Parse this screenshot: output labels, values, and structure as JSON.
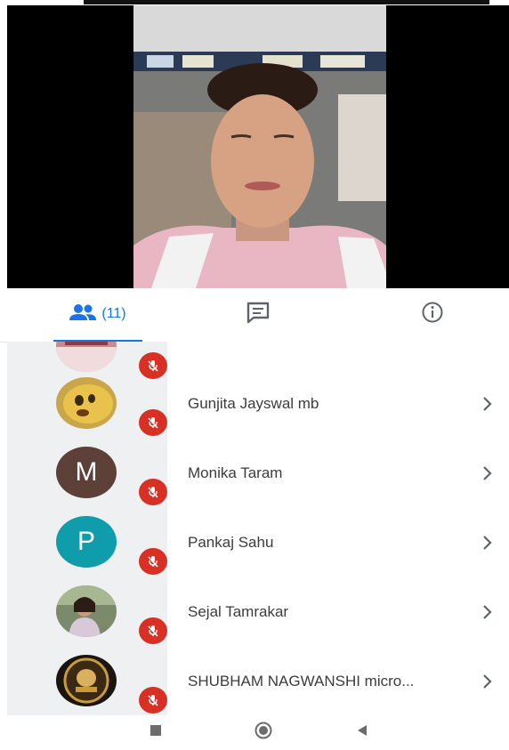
{
  "tabs": {
    "participants_count": "(11)",
    "active": "participants"
  },
  "participants": [
    {
      "name": "",
      "avatar": "photo",
      "muted": true
    },
    {
      "name": "Gunjita Jayswal mb",
      "avatar": "photo",
      "muted": true
    },
    {
      "name": "Monika Taram",
      "avatar": "letter",
      "letter": "M",
      "color": "#5d4037",
      "muted": true
    },
    {
      "name": "Pankaj Sahu",
      "avatar": "letter",
      "letter": "P",
      "color": "#0f9cab",
      "muted": true
    },
    {
      "name": "Sejal Tamrakar",
      "avatar": "photo",
      "muted": true
    },
    {
      "name": "SHUBHAM NAGWANSHI micro...",
      "avatar": "photo",
      "muted": true
    }
  ],
  "icons": {
    "participants_tab": "people-icon",
    "chat_tab": "chat-icon",
    "info_tab": "info-icon",
    "mute_badge": "mic-off-icon",
    "row_action": "chevron-right-icon",
    "nav_recents": "square-icon",
    "nav_home": "circle-icon",
    "nav_back": "triangle-back-icon"
  },
  "colors": {
    "accent": "#1a73e8",
    "mute_red": "#d93025",
    "text": "#3c3c3c",
    "list_background": "#eef0f2"
  }
}
